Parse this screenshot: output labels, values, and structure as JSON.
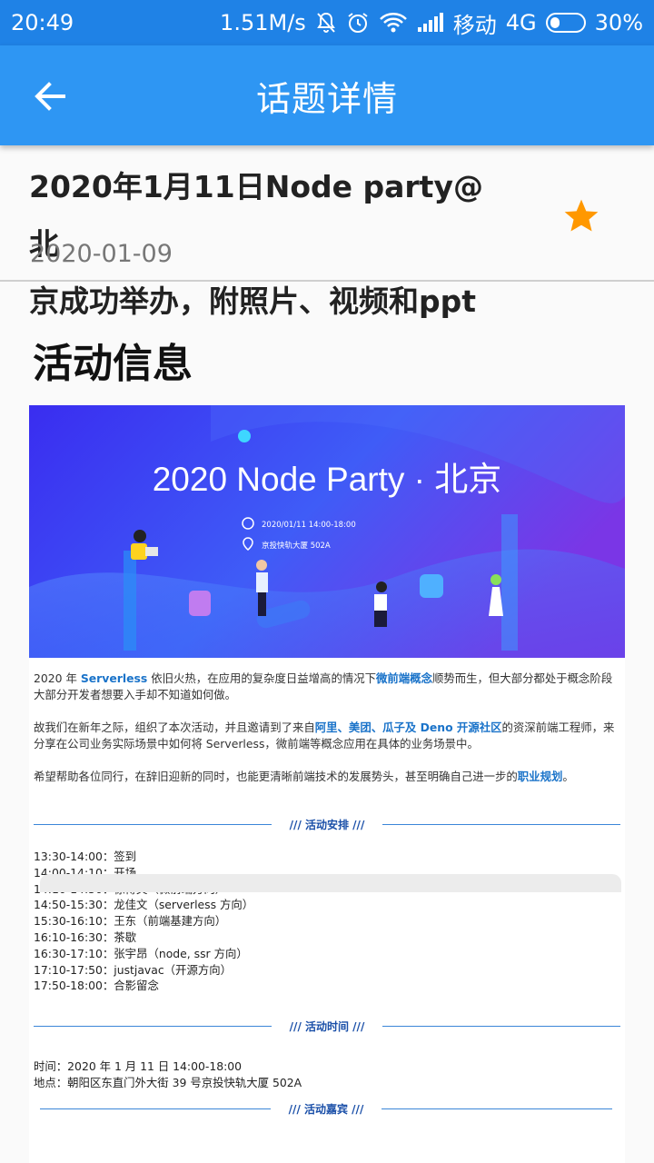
{
  "status_bar": {
    "time": "20:49",
    "speed": "1.51M/s",
    "carrier": "移动",
    "network": "4G",
    "battery": "30%",
    "battery_level": 0.3
  },
  "app_bar": {
    "title": "话题详情",
    "back_icon": "arrow-left-icon"
  },
  "topic": {
    "title_line1": "2020年1月11日Node party@北",
    "title_line2": "京成功举办，附照片、视频和ppt",
    "date": "2020-01-09",
    "favorite_icon": "star-icon",
    "favorite_color": "#ff9800"
  },
  "article": {
    "section_title": "活动信息",
    "banner": {
      "title": "2020 Node Party · 北京",
      "time": "2020/01/11  14:00-18:00",
      "place": "京投快轨大厦 502A"
    },
    "para1": {
      "a": "2020 年 ",
      "b": "Serverless",
      "c": " 依旧火热，在应用的复杂度日益增高的情况下",
      "d": "微前端概念",
      "e": "顺势而生，但大部分都处于概念阶段大部分开发者想要入手却不知道如何做。"
    },
    "para2": {
      "a": "故我们在新年之际，组织了本次活动，并且邀请到了来自",
      "b": "阿里、美团、瓜子及 Deno 开源社区",
      "c": "的资深前端工程师，来分享在公司业务实际场景中如何将 Serverless，微前端等概念应用在具体的业务场景中。"
    },
    "para3": {
      "a": "希望帮助各位同行，在辞旧迎新的同时，也能更清晰前端技术的发展势头，甚至明确自己进一步的",
      "b": "职业规划",
      "c": "。"
    },
    "divider1": "/// 活动安排 ///",
    "schedule": [
      "13:30-14:00：签到",
      "14:00-14:10：开场",
      "14:10-14:50：徐博文（微前端方向）",
      "14:50-15:30：龙佳文（serverless 方向）",
      "15:30-16:10：王东（前端基建方向）",
      "16:10-16:30：茶歇",
      "16:30-17:10：张宇昂（node, ssr 方向）",
      "17:10-17:50：justjavac（开源方向）",
      "17:50-18:00：合影留念"
    ],
    "divider2": "/// 活动时间 ///",
    "time_info": "时间：2020 年 1 月 11 日 14:00-18:00",
    "place_info": "地点：朝阳区东直门外大街 39 号京投快轨大厦 502A",
    "divider3": "/// 活动嘉宾 ///"
  }
}
